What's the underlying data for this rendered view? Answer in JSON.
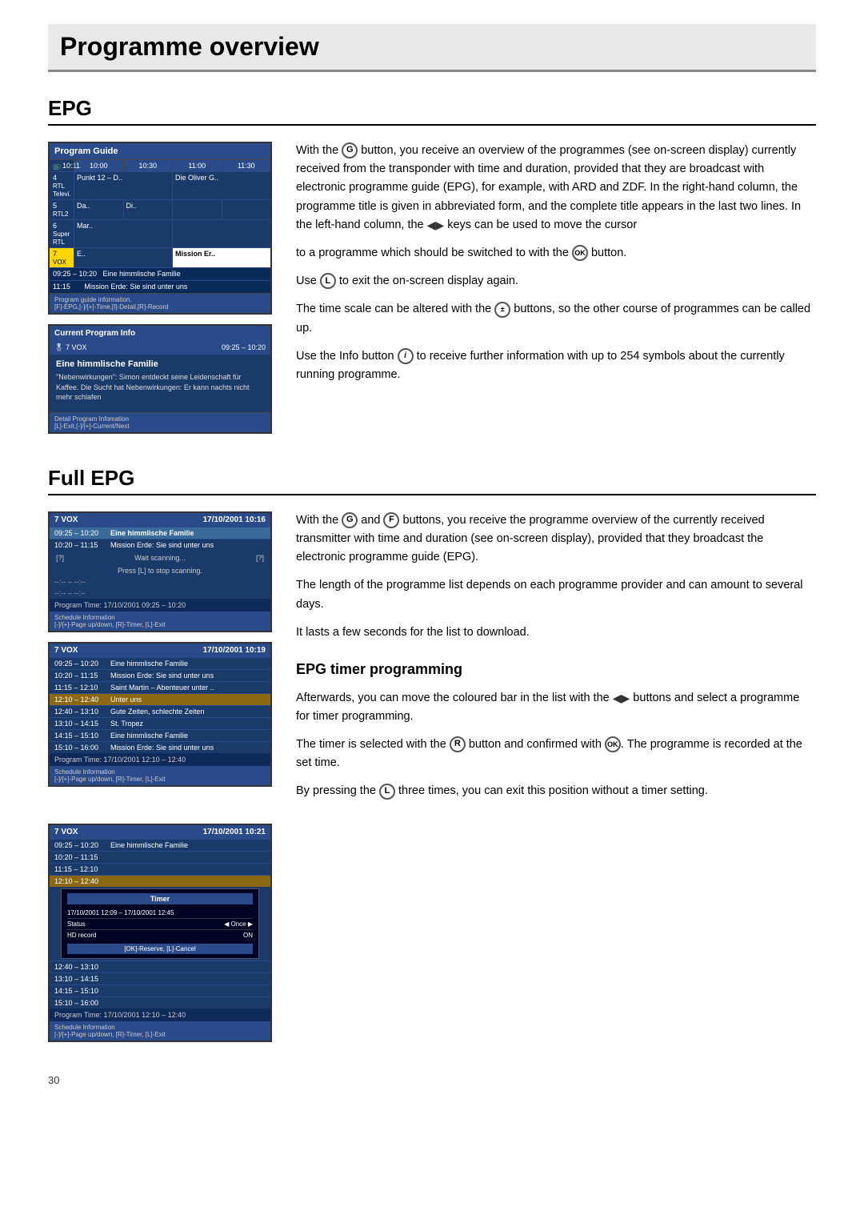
{
  "page": {
    "title": "Programme overview",
    "page_number": "30"
  },
  "epg_section": {
    "heading": "EPG",
    "screen1": {
      "header": "Program Guide",
      "times": [
        "10:00",
        "10:30",
        "11:00",
        "11:30"
      ],
      "icon_time": "10:11",
      "rows": [
        {
          "ch": "4",
          "name": "RTL Televi.",
          "prog1": "Punkt 12 – D..",
          "prog2": "Die Oliver G.."
        },
        {
          "ch": "5",
          "name": "RTL2",
          "prog1": "Da..",
          "prog2": "Di.."
        },
        {
          "ch": "6",
          "name": "Super RTL",
          "prog1": "Mar..",
          "prog2": ""
        },
        {
          "ch": "7",
          "name": "VOX",
          "prog1": "E..",
          "prog2": "Mission Er..",
          "highlight": true
        }
      ],
      "time_rows": [
        {
          "time": "09:25   10:20",
          "prog": "Eine himmlische Familie"
        },
        {
          "time": "11:15",
          "prog": "Mission Erde: Sie sind unter uns"
        }
      ],
      "info_bar": "Program guide information.",
      "info_keys": "[F]-EPG,[-]/[+]-Time,[I]-Detail,[R]-Record"
    },
    "screen2": {
      "header": "Current Program Info",
      "ch_info": "7 VOX",
      "time_info": "09:25  –  10:20",
      "title": "Eine himmlische Familie",
      "desc": "\"Nebenwirkungen\": Simon entdeckt seine Leidenschaft für Kaffee. Die Sucht hat Nebenwirkungen: Er kann nachts nicht mehr schlafen",
      "footer_label": "Detail Program Infomation",
      "footer_keys": "[L]-Exit,[-]/[+]-Current/Next"
    },
    "text": {
      "p1": "With the  button, you receive an overview of the programmes (see on-screen display) currently received from the transponder with time and duration, provided that they are broadcast with electronic programme guide (EPG), for example, with ARD and ZDF. In the right-hand column, the programme title is given in abbreviated form, and the complete title appears in the last two lines. In the left-hand column, the        keys can be used to move the cursor to a programme which should be switched to with the  button.",
      "p1_part1": "With the",
      "p1_btn": "G",
      "p1_part2": "button, you receive an overview of the programmes (see on-screen display) currently received from the transponder with time and duration, provided that they are broadcast with electronic programme guide (EPG), for example, with ARD and ZDF. In the right-hand column, the programme title is given in abbreviated form, and the complete title appears in the last two lines. In the left-hand column, the",
      "p1_arrows": "◀▶",
      "p1_part3": "keys can be used to move the cursor to a programme which should be switched to with the",
      "p1_btn2": "OK",
      "p1_part4": "button.",
      "p2_part1": "Use",
      "p2_btn": "L",
      "p2_part2": "to exit the on-screen display again.",
      "p3_part1": "The time scale can be altered with the",
      "p3_btn": "±",
      "p3_part2": "buttons, so the other course of programmes can be called up.",
      "p4_part1": "Use the Info button",
      "p4_btn": "i",
      "p4_part2": "to receive further information with up to 254 symbols about the currently running programme."
    }
  },
  "full_epg_section": {
    "heading": "Full EPG",
    "screen1": {
      "header_ch": "7 VOX",
      "header_date": "17/10/2001 10:16",
      "rows": [
        {
          "time": "09:25 – 10:20",
          "prog": "Eine himmlische Familie",
          "highlight": true
        },
        {
          "time": "10:20 – 11:15",
          "prog": "Mission Erde: Sie sind unter uns",
          "highlight": false
        }
      ],
      "wait_left": "?",
      "wait_right": "?",
      "wait_text": "Wait scanning...",
      "press_text": "Press [L] to stop scanning.",
      "sep1": "--:-- – --:--",
      "sep2": "--:-- – --:--",
      "prog_time_label": "Program Time:",
      "prog_time": "17/10/2001 09:25 – 10:20",
      "footer_label": "Schedule Information",
      "footer_keys": "[-]/[+]-Page up/down, [R]-Timer, [L]-Exit"
    },
    "screen2": {
      "header_ch": "7 VOX",
      "header_date": "17/10/2001 10:19",
      "rows": [
        {
          "time": "09:25 – 10:20",
          "prog": "Eine himmlische Familie",
          "style": "normal"
        },
        {
          "time": "10:20 – 11:15",
          "prog": "Mission Erde: Sie sind unter uns",
          "style": "normal"
        },
        {
          "time": "11:15 – 12:10",
          "prog": "Saint Martin – Abenteuer unter ..",
          "style": "normal"
        },
        {
          "time": "12:10 – 12:40",
          "prog": "Unter uns",
          "style": "yellow"
        },
        {
          "time": "12:40 – 13:10",
          "prog": "Gute Zeiten, schlechte Zeiten",
          "style": "normal"
        },
        {
          "time": "13:10 – 14:15",
          "prog": "St. Tropez",
          "style": "normal"
        },
        {
          "time": "14:15 – 15:10",
          "prog": "Eine himmlische Familie",
          "style": "normal"
        },
        {
          "time": "15:10 – 16:00",
          "prog": "Mission Erde: Sie sind unter uns",
          "style": "normal"
        }
      ],
      "prog_time_label": "Program Time:",
      "prog_time": "17/10/2001 12:10 – 12:40",
      "footer_label": "Schedule Information",
      "footer_keys": "[-]/[+]-Page up/down, [R]-Timer, [L]-Exit"
    },
    "screen3": {
      "header_ch": "7 VOX",
      "header_date": "17/10/2001 10:21",
      "rows": [
        {
          "time": "09:25 – 10:20",
          "prog": "Eine himmlische Familie",
          "style": "normal"
        },
        {
          "time": "10:20 – 11:15",
          "prog": "",
          "style": "normal"
        },
        {
          "time": "11:15 – 12:10",
          "prog": "",
          "style": "normal"
        },
        {
          "time": "12:10 – 12:40",
          "prog": "",
          "style": "yellow"
        }
      ],
      "timer_overlay": {
        "title": "Timer",
        "row1_label": "17/10/2001 12:09",
        "row1_sep": "–",
        "row1_value": "17/10/2001 12:45",
        "row2_label": "Status",
        "row2_value": "Once",
        "row3_label": "HD record",
        "row3_value": "ON",
        "btn": "[OK]-Reserve, [L]-Cancel"
      },
      "more_rows": [
        {
          "time": "12:40 – 13:10",
          "prog": "",
          "style": "normal"
        },
        {
          "time": "13:10 – 14:15",
          "prog": "",
          "style": "normal"
        },
        {
          "time": "14:15 – 15:10",
          "prog": "",
          "style": "normal"
        },
        {
          "time": "15:10 – 16:00",
          "prog": "",
          "style": "normal"
        }
      ],
      "prog_time_label": "Program Time:",
      "prog_time": "17/10/2001 12:10 – 12:40",
      "footer_label": "Schedule Information",
      "footer_keys": "[-]/[+]-Page up/down, [R]-Timer, [L]-Exit"
    },
    "text": {
      "p1_part1": "With the",
      "p1_btn1": "G",
      "p1_and": "and",
      "p1_btn2": "F",
      "p1_part2": "buttons, you receive the programme overview of the currently received transmitter with time and duration (see on-screen display), provided that they broadcast the electronic programme guide (EPG).",
      "p2": "The length of the programme list depends on each programme provider and can amount to several days.",
      "p3": "It lasts a few seconds for the list to download."
    },
    "epg_timer": {
      "heading": "EPG timer programming",
      "p1_part1": "Afterwards, you can move the coloured bar in the list with the",
      "p1_arrows": "◀▶",
      "p1_part2": "buttons and select a programme for timer programming.",
      "p2_part1": "The timer is selected with the",
      "p2_btn1": "R",
      "p2_part2": "button and confirmed with",
      "p2_btn2": "OK",
      "p2_part3": ". The programme is recorded at the set time.",
      "p3_part1": "By pressing the",
      "p3_btn": "L",
      "p3_part2": "three times, you can exit this position without a timer setting."
    }
  }
}
